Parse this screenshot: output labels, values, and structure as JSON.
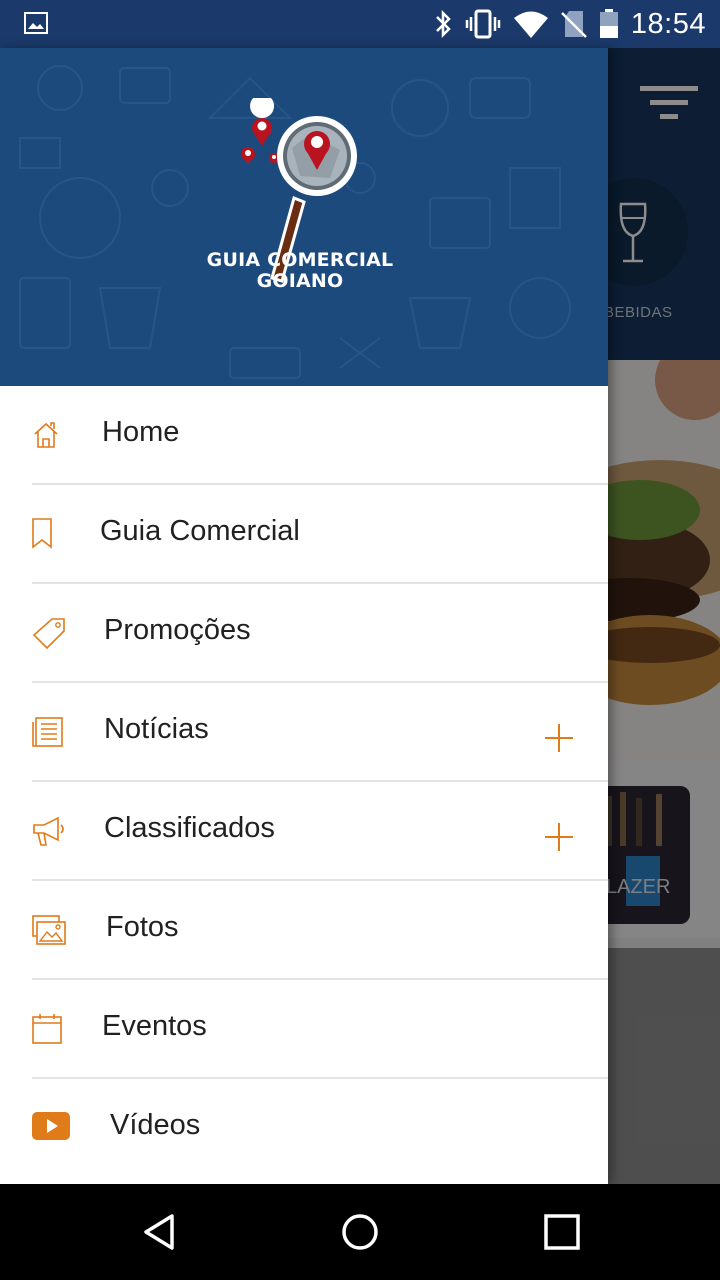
{
  "status_bar": {
    "time": "18:54",
    "icons": [
      "image-icon",
      "bluetooth-icon",
      "vibrate-icon",
      "wifi-icon",
      "no-sim-icon",
      "battery-icon"
    ]
  },
  "background": {
    "category_label": "BEBIDAS",
    "card_label": "LAZER"
  },
  "drawer": {
    "brand_line1": "GUIA COMERCIAL",
    "brand_line2": "GOIANO",
    "items": [
      {
        "label": "Home",
        "icon": "home-icon",
        "expandable": false
      },
      {
        "label": "Guia Comercial",
        "icon": "bookmark-icon",
        "expandable": false
      },
      {
        "label": "Promoções",
        "icon": "tag-icon",
        "expandable": false
      },
      {
        "label": "Notícias",
        "icon": "news-icon",
        "expandable": true
      },
      {
        "label": "Classificados",
        "icon": "megaphone-icon",
        "expandable": true
      },
      {
        "label": "Fotos",
        "icon": "photos-icon",
        "expandable": false
      },
      {
        "label": "Eventos",
        "icon": "calendar-icon",
        "expandable": false
      },
      {
        "label": "Vídeos",
        "icon": "play-icon",
        "expandable": false
      }
    ]
  },
  "colors": {
    "accent": "#e07b1a",
    "header_blue": "#1c4a7d",
    "status_blue": "#1b3a6b"
  }
}
